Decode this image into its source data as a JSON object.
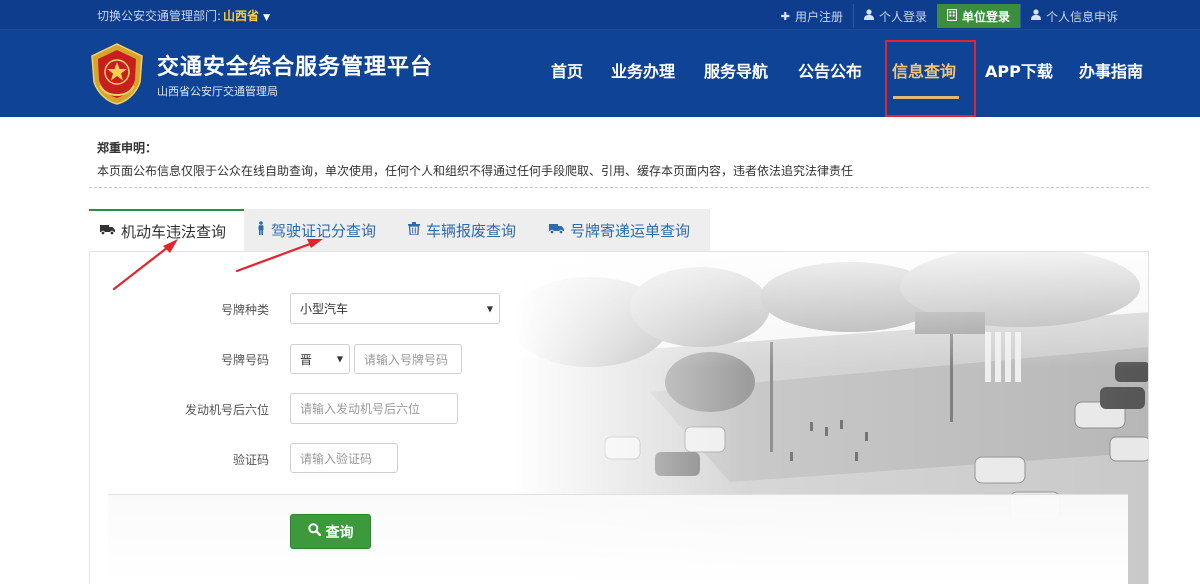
{
  "topbar": {
    "dept_label": "切换公安交通管理部门:",
    "dept_value": "山西省",
    "links": [
      {
        "label": "用户注册",
        "icon": "plus-icon"
      },
      {
        "label": "个人登录",
        "icon": "user-icon"
      },
      {
        "label": "单位登录",
        "icon": "building-icon",
        "active": true
      },
      {
        "label": "个人信息申诉",
        "icon": "user-icon"
      }
    ]
  },
  "header": {
    "title": "交通安全综合服务管理平台",
    "subtitle": "山西省公安厅交通管理局",
    "nav": [
      "首页",
      "业务办理",
      "服务导航",
      "公告公布",
      "信息查询",
      "APP下载",
      "办事指南"
    ],
    "active_nav": "信息查询"
  },
  "notice": {
    "title": "郑重申明：",
    "body": "本页面公布信息仅限于公众在线自助查询，单次使用，任何个人和组织不得通过任何手段爬取、引用、缓存本页面内容，违者依法追究法律责任"
  },
  "tabs": [
    {
      "label": "机动车违法查询",
      "icon": "truck-icon",
      "active": true
    },
    {
      "label": "驾驶证记分查询",
      "icon": "person-icon"
    },
    {
      "label": "车辆报废查询",
      "icon": "trash-icon"
    },
    {
      "label": "号牌寄递运单查询",
      "icon": "truck-icon"
    }
  ],
  "form": {
    "plate_type_label": "号牌种类",
    "plate_type_value": "小型汽车",
    "plate_no_label": "号牌号码",
    "plate_prefix_value": "晋",
    "plate_no_placeholder": "请输入号牌号码",
    "engine_label": "发动机号后六位",
    "engine_placeholder": "请输入发动机号后六位",
    "captcha_label": "验证码",
    "captcha_placeholder": "请输入验证码",
    "submit_label": "查询"
  },
  "colors": {
    "header_bg": "#0e4395",
    "topbar_bg": "#0d3d8c",
    "accent_gold": "#f1c27a",
    "active_green": "#3c8d3c",
    "highlight_red": "#e3242b",
    "tab_link": "#2c6bb0"
  }
}
